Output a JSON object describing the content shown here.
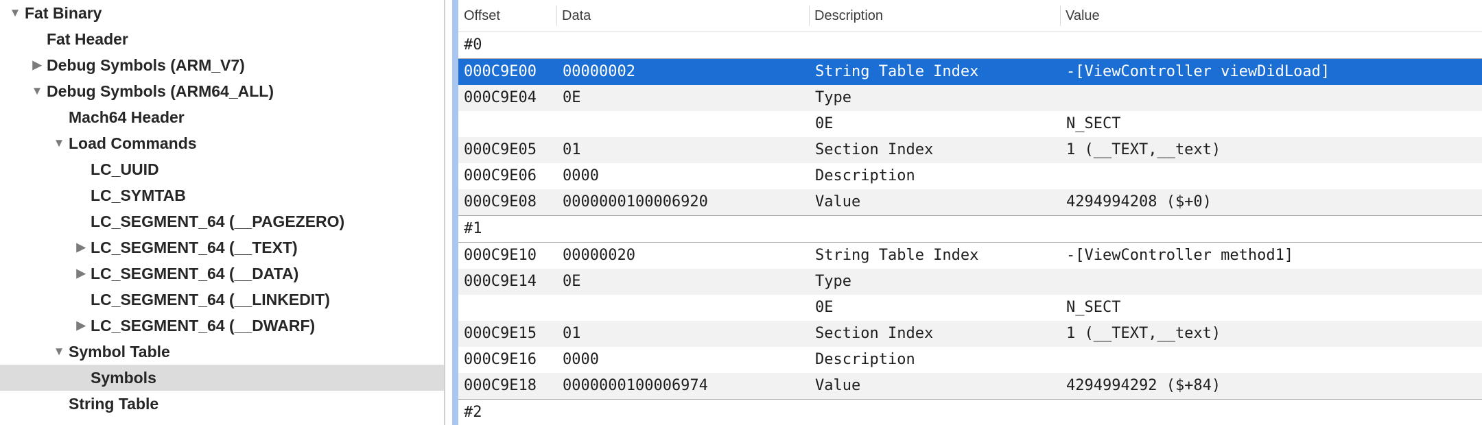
{
  "sidebar": {
    "items": [
      {
        "label": "Fat Binary",
        "level": 0,
        "disclosure": "expanded"
      },
      {
        "label": "Fat Header",
        "level": 1,
        "disclosure": "none"
      },
      {
        "label": "Debug Symbols (ARM_V7)",
        "level": 1,
        "disclosure": "collapsed"
      },
      {
        "label": "Debug Symbols (ARM64_ALL)",
        "level": 1,
        "disclosure": "expanded"
      },
      {
        "label": "Mach64 Header",
        "level": 2,
        "disclosure": "none"
      },
      {
        "label": "Load Commands",
        "level": 2,
        "disclosure": "expanded"
      },
      {
        "label": "LC_UUID",
        "level": 3,
        "disclosure": "none"
      },
      {
        "label": "LC_SYMTAB",
        "level": 3,
        "disclosure": "none"
      },
      {
        "label": "LC_SEGMENT_64 (__PAGEZERO)",
        "level": 3,
        "disclosure": "none"
      },
      {
        "label": "LC_SEGMENT_64 (__TEXT)",
        "level": 3,
        "disclosure": "collapsed"
      },
      {
        "label": "LC_SEGMENT_64 (__DATA)",
        "level": 3,
        "disclosure": "collapsed"
      },
      {
        "label": "LC_SEGMENT_64 (__LINKEDIT)",
        "level": 3,
        "disclosure": "none"
      },
      {
        "label": "LC_SEGMENT_64 (__DWARF)",
        "level": 3,
        "disclosure": "collapsed"
      },
      {
        "label": "Symbol Table",
        "level": 2,
        "disclosure": "expanded"
      },
      {
        "label": "Symbols",
        "level": 3,
        "disclosure": "none",
        "selected": true
      },
      {
        "label": "String Table",
        "level": 2,
        "disclosure": "none"
      }
    ]
  },
  "table": {
    "headers": {
      "offset": "Offset",
      "data": "Data",
      "description": "Description",
      "value": "Value"
    },
    "rows": [
      {
        "kind": "group",
        "label": "#0"
      },
      {
        "offset": "000C9E00",
        "data": "00000002",
        "description": "String Table Index",
        "value": "-[ViewController viewDidLoad]",
        "selected": true
      },
      {
        "offset": "000C9E04",
        "data": "0E",
        "description": "Type",
        "value": ""
      },
      {
        "offset": "",
        "data": "",
        "description": "0E",
        "value": "N_SECT"
      },
      {
        "offset": "000C9E05",
        "data": "01",
        "description": "Section Index",
        "value": "1 (__TEXT,__text)"
      },
      {
        "offset": "000C9E06",
        "data": "0000",
        "description": "Description",
        "value": ""
      },
      {
        "offset": "000C9E08",
        "data": "0000000100006920",
        "description": "Value",
        "value": "4294994208 ($+0)",
        "end": true
      },
      {
        "kind": "group",
        "label": "#1"
      },
      {
        "offset": "000C9E10",
        "data": "00000020",
        "description": "String Table Index",
        "value": "-[ViewController method1]"
      },
      {
        "offset": "000C9E14",
        "data": "0E",
        "description": "Type",
        "value": ""
      },
      {
        "offset": "",
        "data": "",
        "description": "0E",
        "value": "N_SECT"
      },
      {
        "offset": "000C9E15",
        "data": "01",
        "description": "Section Index",
        "value": "1 (__TEXT,__text)"
      },
      {
        "offset": "000C9E16",
        "data": "0000",
        "description": "Description",
        "value": ""
      },
      {
        "offset": "000C9E18",
        "data": "0000000100006974",
        "description": "Value",
        "value": "4294994292 ($+84)",
        "end": true
      },
      {
        "kind": "group",
        "label": "#2"
      }
    ]
  },
  "colors": {
    "selection": "#1b6ed4",
    "sidebar_selection": "#dcdcdc",
    "focus_bar": "#a8c6f0"
  }
}
